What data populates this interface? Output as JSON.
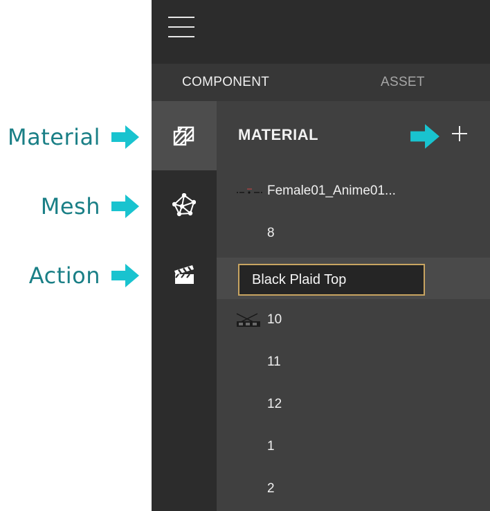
{
  "annotations": [
    {
      "label": "Material"
    },
    {
      "label": "Mesh"
    },
    {
      "label": "Action"
    }
  ],
  "colors": {
    "annotation_text": "#1a7f86",
    "arrow": "#19c3cf",
    "rename_border": "#c9a561"
  },
  "tabs": [
    {
      "label": "COMPONENT",
      "active": true
    },
    {
      "label": "ASSET",
      "active": false
    }
  ],
  "rail": [
    {
      "icon": "material-icon",
      "active": true
    },
    {
      "icon": "mesh-icon",
      "active": false
    },
    {
      "icon": "action-clapperboard-icon",
      "active": false
    }
  ],
  "panel": {
    "title": "MATERIAL",
    "add_icon": "plus-icon",
    "items": [
      {
        "label": "Female01_Anime01...",
        "thumb": "character-thumbnail"
      },
      {
        "label": "8"
      },
      {
        "label": "",
        "value": "Black Plaid Top",
        "editing": true
      },
      {
        "label": "10",
        "thumb": "outfit-thumbnail"
      },
      {
        "label": "11"
      },
      {
        "label": "12"
      },
      {
        "label": "1"
      },
      {
        "label": "2"
      }
    ]
  }
}
